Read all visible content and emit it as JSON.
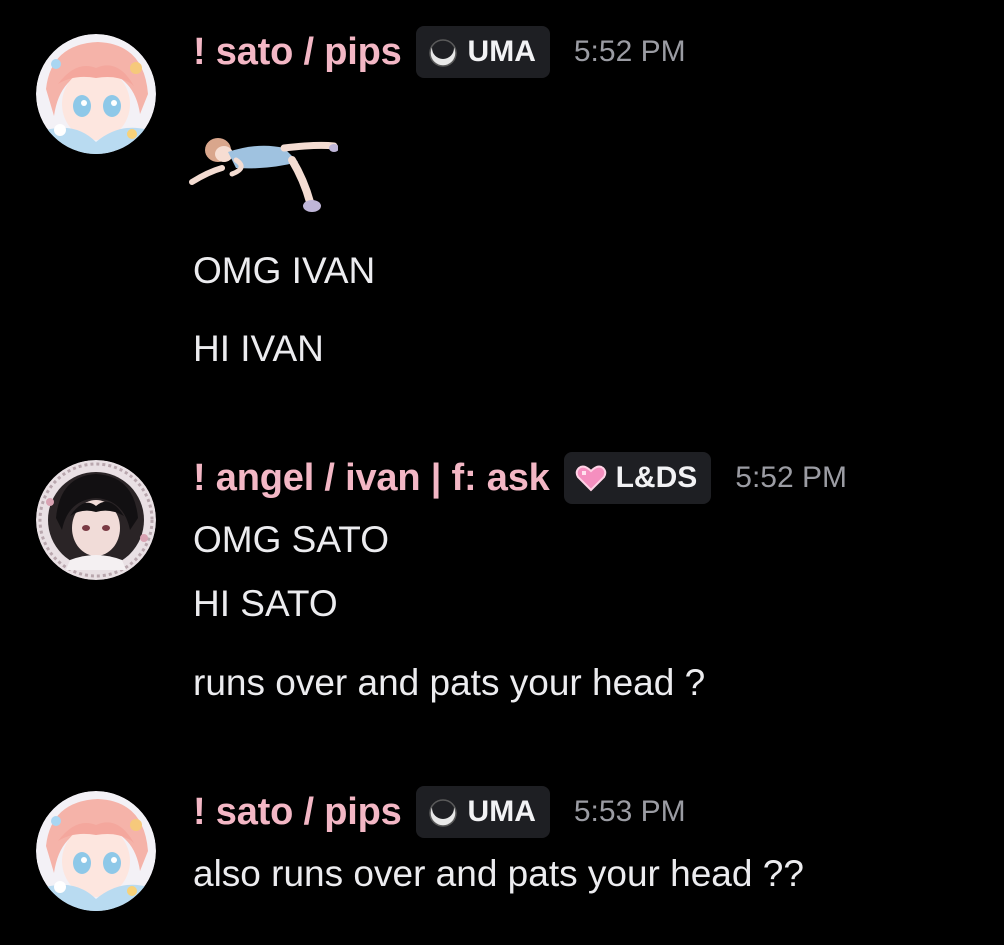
{
  "messages": [
    {
      "username": "! sato / pips",
      "username_color": "#f3b7c5",
      "tag": {
        "label": "UMA",
        "icon": "crescent-moon-icon"
      },
      "time": "5:52 PM",
      "sticker": "lying-girl-sticker",
      "lines": [
        "OMG IVAN",
        "HI IVAN"
      ]
    },
    {
      "username": "! angel / ivan | f: ask",
      "username_color": "#f3b7c5",
      "tag": {
        "label": "L&DS",
        "icon": "pink-heart-icon"
      },
      "time": "5:52 PM",
      "lines": [
        "OMG SATO",
        "HI SATO",
        "runs over and   pats your head ?"
      ]
    },
    {
      "username": "! sato / pips",
      "username_color": "#f3b7c5",
      "tag": {
        "label": "UMA",
        "icon": "crescent-moon-icon"
      },
      "time": "5:53 PM",
      "lines": [
        "also runs over and  pats your head ??"
      ]
    }
  ]
}
